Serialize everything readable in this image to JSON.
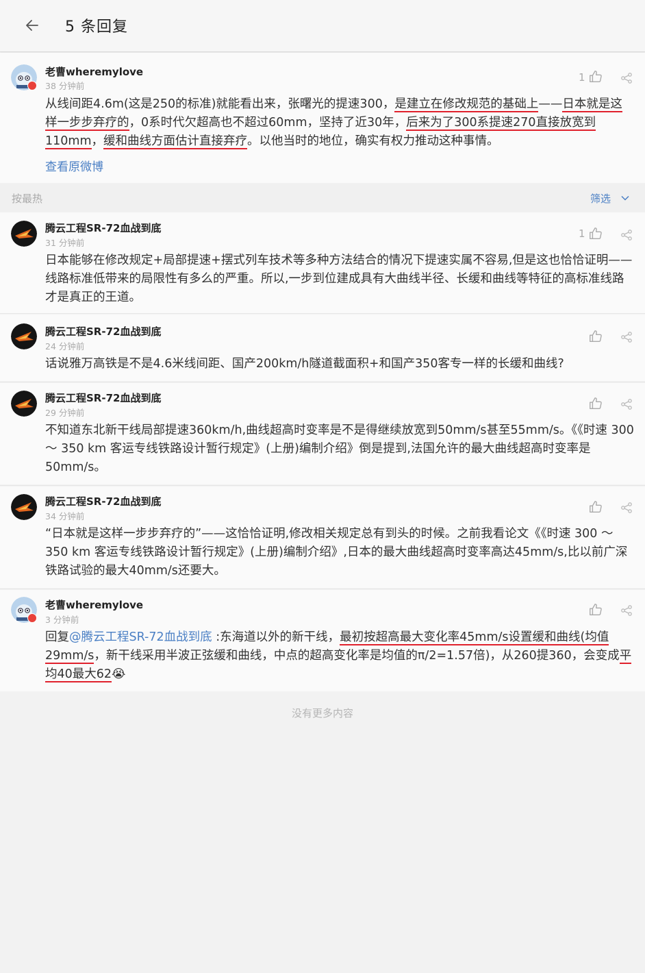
{
  "header": {
    "title": "5 条回复"
  },
  "original_post": {
    "author": "老曹wheremylove",
    "time": "38 分钟前",
    "likes": "1",
    "segments": [
      {
        "t": "从线间距4.6m(这是250的标准)就能看出来，张曙光的提速300，"
      },
      {
        "t": "是建立在修改规范的基础上",
        "u": true
      },
      {
        "t": "——"
      },
      {
        "t": "日本就是这样一步步弃疗的",
        "u": true
      },
      {
        "t": "，0系时代欠超高也不超过60mm，坚持了近30年，"
      },
      {
        "t": "后来为了300系提速270直接放宽到110mm",
        "u": true
      },
      {
        "t": "，"
      },
      {
        "t": "缓和曲线方面估计直接弃疗",
        "u": true
      },
      {
        "t": "。以他当时的地位，确实有权力推动这种事情。"
      }
    ],
    "link_label": "查看原微博"
  },
  "sortbar": {
    "label": "按最热",
    "filter_label": "筛选"
  },
  "replies": [
    {
      "author": "腾云工程SR-72血战到底",
      "time": "31 分钟前",
      "likes": "1",
      "segments": [
        {
          "t": "日本能够在修改规定+局部提速+摆式列车技术等多种方法结合的情况下提速实属不容易,但是这也恰恰证明——线路标准低带来的局限性有多么的严重。所以,一步到位建成具有大曲线半径、长缓和曲线等特征的高标准线路才是真正的王道。"
        }
      ]
    },
    {
      "author": "腾云工程SR-72血战到底",
      "time": "24 分钟前",
      "likes": "",
      "segments": [
        {
          "t": "话说雅万高铁是不是4.6米线间距、国产200km/h隧道截面积+和国产350客专一样的长缓和曲线?"
        }
      ]
    },
    {
      "author": "腾云工程SR-72血战到底",
      "time": "29 分钟前",
      "likes": "",
      "segments": [
        {
          "t": "不知道东北新干线局部提速360km/h,曲线超高时变率是不是得继续放宽到50mm/s甚至55mm/s。《《时速 300 ～ 350 km 客运专线铁路设计暂行规定》(上册)编制介绍》倒是提到,法国允许的最大曲线超高时变率是50mm/s。"
        }
      ]
    },
    {
      "author": "腾云工程SR-72血战到底",
      "time": "34 分钟前",
      "likes": "",
      "segments": [
        {
          "t": "“日本就是这样一步步弃疗的”——这恰恰证明,修改相关规定总有到头的时候。之前我看论文《《时速 300 ～ 350 km 客运专线铁路设计暂行规定》(上册)编制介绍》,日本的最大曲线超高时变率高达45mm/s,比以前广深铁路试验的最大40mm/s还要大。"
        }
      ]
    },
    {
      "author": "老曹wheremylove",
      "time": "3 分钟前",
      "likes": "",
      "segments": [
        {
          "t": "回复"
        },
        {
          "t": "@腾云工程SR-72血战到底",
          "link": true
        },
        {
          "t": " :东海道以外的新干线，"
        },
        {
          "t": "最初按超高最大变化率45mm/s设置缓和曲线(均值29mm/s",
          "u": true
        },
        {
          "t": "，新干线采用半波正弦缓和曲线，中点的超高变化率是均值的π/2=1.57倍)，从260提360，会变成"
        },
        {
          "t": "平均40最大62",
          "u": true
        },
        {
          "t": "😭"
        }
      ]
    }
  ],
  "footer": {
    "no_more": "没有更多内容"
  },
  "colors": {
    "link": "#4a7fc4",
    "underline": "#e0212c",
    "badge": "#e8413a"
  },
  "icons": {
    "back": "back-arrow-icon",
    "like": "thumbs-up-icon",
    "share": "share-icon",
    "filter": "chevron-down-icon"
  }
}
